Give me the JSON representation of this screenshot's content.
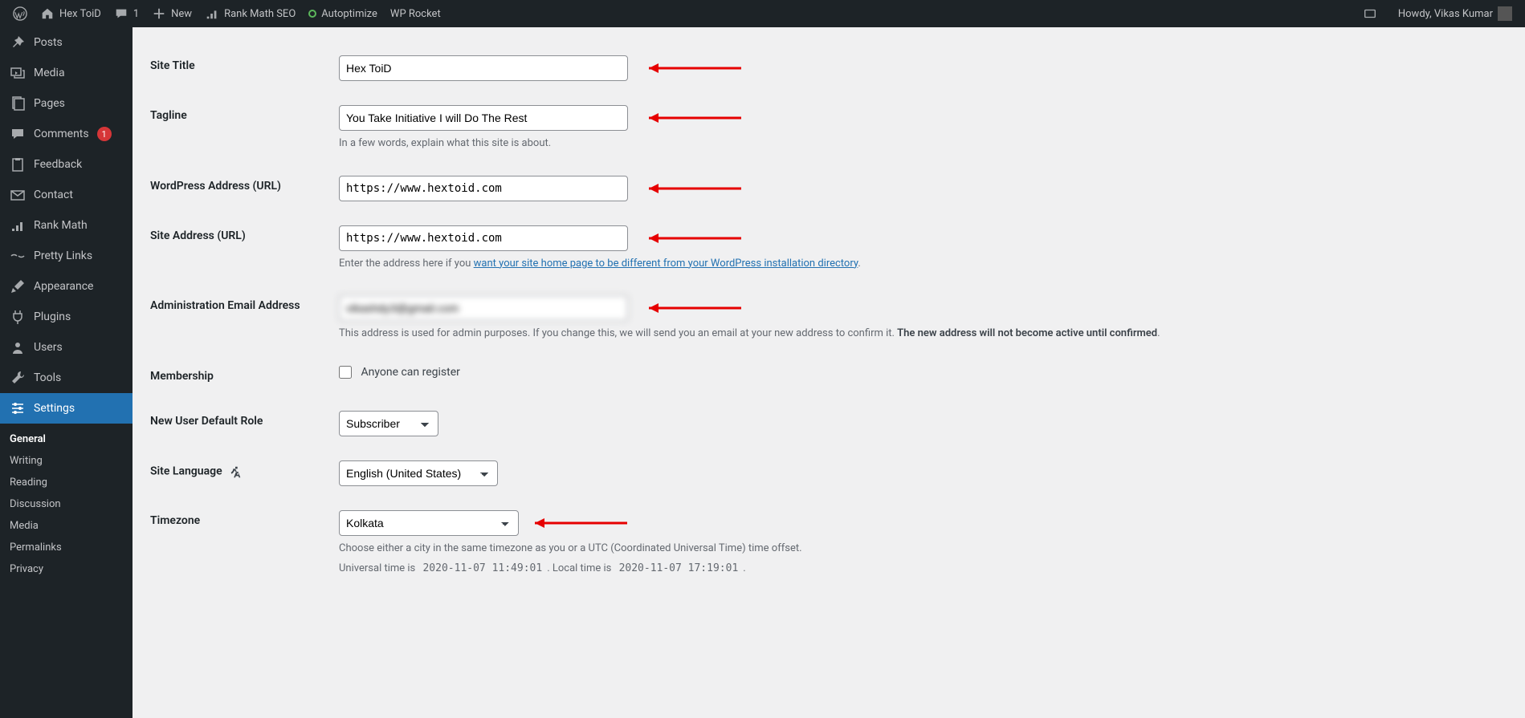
{
  "topbar": {
    "site_name": "Hex ToiD",
    "comments_count": "1",
    "new_label": "New",
    "rankmath_label": "Rank Math SEO",
    "autoptimize_label": "Autoptimize",
    "wprocket_label": "WP Rocket",
    "greeting": "Howdy, Vikas Kumar"
  },
  "sidebar": {
    "posts": "Posts",
    "media": "Media",
    "pages": "Pages",
    "comments": "Comments",
    "comments_count": "1",
    "feedback": "Feedback",
    "contact": "Contact",
    "rankmath": "Rank Math",
    "prettylinks": "Pretty Links",
    "appearance": "Appearance",
    "plugins": "Plugins",
    "users": "Users",
    "tools": "Tools",
    "settings": "Settings",
    "submenu": {
      "general": "General",
      "writing": "Writing",
      "reading": "Reading",
      "discussion": "Discussion",
      "media": "Media",
      "permalinks": "Permalinks",
      "privacy": "Privacy"
    }
  },
  "form": {
    "site_title": {
      "label": "Site Title",
      "value": "Hex ToiD"
    },
    "tagline": {
      "label": "Tagline",
      "value": "You Take Initiative I will Do The Rest",
      "desc": "In a few words, explain what this site is about."
    },
    "wp_address": {
      "label": "WordPress Address (URL)",
      "value": "https://www.hextoid.com"
    },
    "site_address": {
      "label": "Site Address (URL)",
      "value": "https://www.hextoid.com",
      "desc_pre": "Enter the address here if you ",
      "desc_link": "want your site home page to be different from your WordPress installation directory",
      "desc_post": "."
    },
    "admin_email": {
      "label": "Administration Email Address",
      "value": "vikashdy3@gmail.com",
      "desc_plain": "This address is used for admin purposes. If you change this, we will send you an email at your new address to confirm it. ",
      "desc_strong": "The new address will not become active until confirmed",
      "desc_end": "."
    },
    "membership": {
      "label": "Membership",
      "checkbox": "Anyone can register"
    },
    "default_role": {
      "label": "New User Default Role",
      "value": "Subscriber"
    },
    "language": {
      "label": "Site Language",
      "value": "English (United States)"
    },
    "timezone": {
      "label": "Timezone",
      "value": "Kolkata",
      "desc": "Choose either a city in the same timezone as you or a UTC (Coordinated Universal Time) time offset.",
      "utc_label": "Universal time is ",
      "utc_value": "2020-11-07 11:49:01",
      "local_label": ". Local time is ",
      "local_value": "2020-11-07 17:19:01",
      "end": "."
    }
  }
}
